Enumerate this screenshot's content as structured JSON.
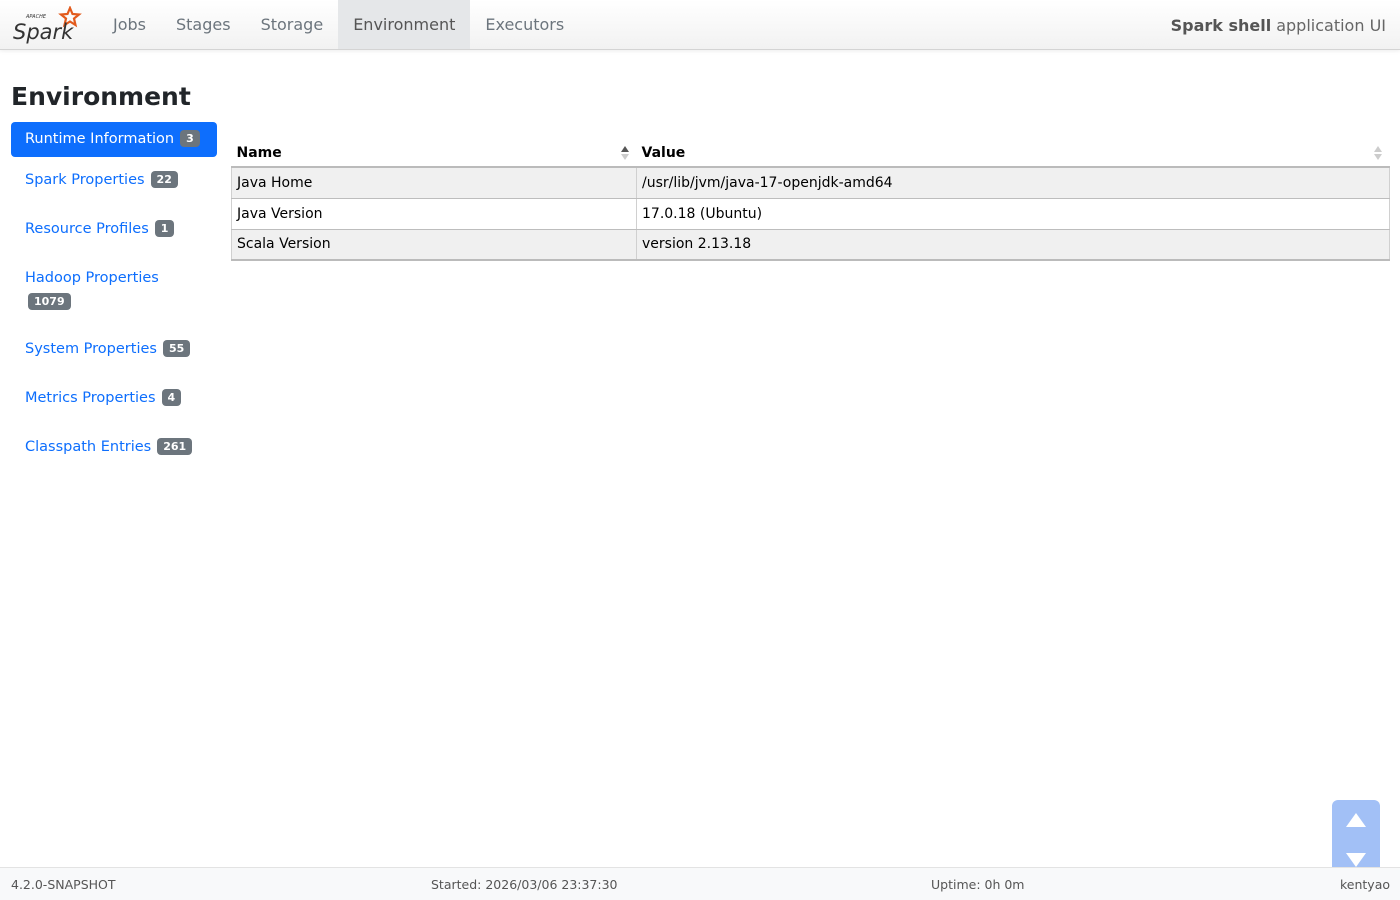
{
  "nav": {
    "tabs": [
      {
        "label": "Jobs",
        "active": false
      },
      {
        "label": "Stages",
        "active": false
      },
      {
        "label": "Storage",
        "active": false
      },
      {
        "label": "Environment",
        "active": true
      },
      {
        "label": "Executors",
        "active": false
      }
    ],
    "app_name": "Spark shell",
    "app_suffix": "application UI",
    "logo_small": "APACHE",
    "logo_text": "Spark"
  },
  "page": {
    "title": "Environment"
  },
  "sidebar": {
    "items": [
      {
        "label": "Runtime Information",
        "count": "3",
        "active": true
      },
      {
        "label": "Spark Properties",
        "count": "22",
        "active": false
      },
      {
        "label": "Resource Profiles",
        "count": "1",
        "active": false
      },
      {
        "label": "Hadoop Properties",
        "count": "1079",
        "active": false
      },
      {
        "label": "System Properties",
        "count": "55",
        "active": false
      },
      {
        "label": "Metrics Properties",
        "count": "4",
        "active": false
      },
      {
        "label": "Classpath Entries",
        "count": "261",
        "active": false
      }
    ]
  },
  "table": {
    "headers": [
      "Name",
      "Value"
    ],
    "rows": [
      [
        "Java Home",
        "/usr/lib/jvm/java-17-openjdk-amd64"
      ],
      [
        "Java Version",
        "17.0.18 (Ubuntu)"
      ],
      [
        "Scala Version",
        "version 2.13.18"
      ]
    ]
  },
  "footer": {
    "version": "4.2.0-SNAPSHOT",
    "started": "Started: 2026/03/06 23:37:30",
    "uptime": "Uptime: 0h 0m",
    "user": "kentyao"
  },
  "colors": {
    "accent": "#0d6efd",
    "badge": "#6c757d",
    "logo_star": "#e25a1c"
  },
  "icons": {
    "sort": "sort-icon",
    "scroll_up": "triangle-up-icon",
    "scroll_down": "triangle-down-icon"
  }
}
